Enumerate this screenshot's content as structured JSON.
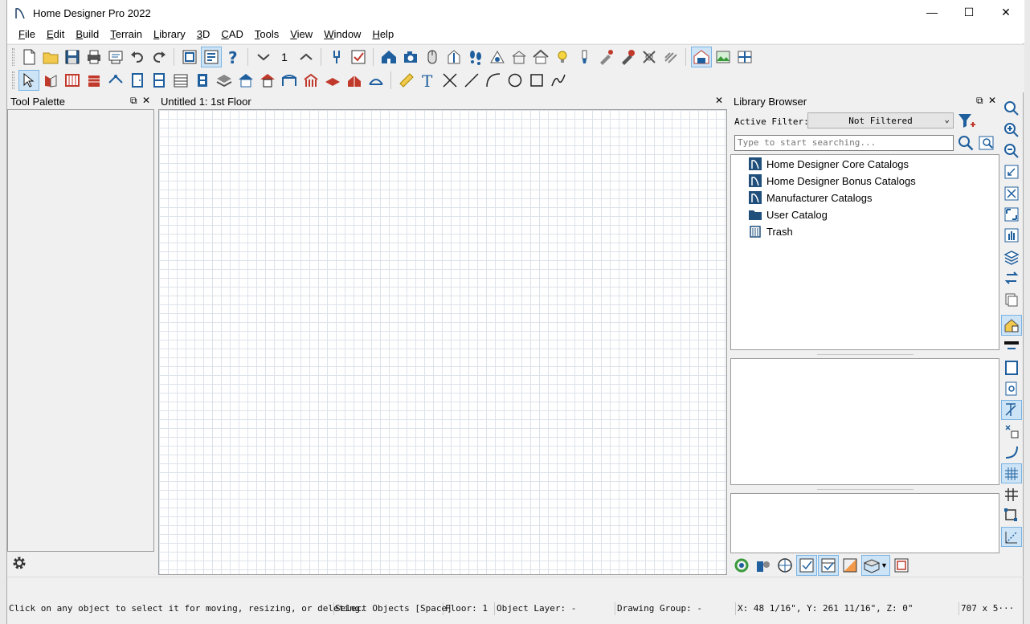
{
  "window": {
    "title": "Home Designer Pro 2022",
    "minimize": "—",
    "maximize": "☐",
    "close": "✕"
  },
  "menu": [
    {
      "label": "File",
      "key": "F"
    },
    {
      "label": "Edit",
      "key": "E"
    },
    {
      "label": "Build",
      "key": "B"
    },
    {
      "label": "Terrain",
      "key": "T"
    },
    {
      "label": "Library",
      "key": "L"
    },
    {
      "label": "3D",
      "key": "3"
    },
    {
      "label": "CAD",
      "key": "C"
    },
    {
      "label": "Tools",
      "key": "T"
    },
    {
      "label": "View",
      "key": "V"
    },
    {
      "label": "Window",
      "key": "W"
    },
    {
      "label": "Help",
      "key": "H"
    }
  ],
  "toolbar": {
    "floor_number": "1"
  },
  "tool_palette": {
    "title": "Tool Palette",
    "pin": "⧉",
    "close": "✕"
  },
  "drawing": {
    "title": "Untitled 1: 1st Floor",
    "close": "✕"
  },
  "library": {
    "title": "Library Browser",
    "pin": "⧉",
    "close": "✕",
    "active_filter_label": "Active Filter:",
    "filter_value": "Not Filtered",
    "search_placeholder": "Type to start searching...",
    "items": [
      {
        "label": "Home Designer Core Catalogs",
        "icon": "catalog-icon"
      },
      {
        "label": "Home Designer Bonus Catalogs",
        "icon": "catalog-icon"
      },
      {
        "label": "Manufacturer Catalogs",
        "icon": "catalog-icon"
      },
      {
        "label": "User Catalog",
        "icon": "folder-icon"
      },
      {
        "label": "Trash",
        "icon": "trash-icon"
      }
    ]
  },
  "status": {
    "message": "Click on any object to select it for moving, resizing, or deleting.",
    "mode": "Select Objects [Space]",
    "floor": "Floor: 1",
    "layer": "Object Layer: -",
    "group": "Drawing Group: -",
    "coords": "X: 48 1/16\", Y: 261 11/16\", Z: 0\"",
    "size": "707 x 5···"
  },
  "colors": {
    "accent": "#1f5f9e",
    "active_button": "#cde4f7",
    "grid": "#dde2ea"
  }
}
